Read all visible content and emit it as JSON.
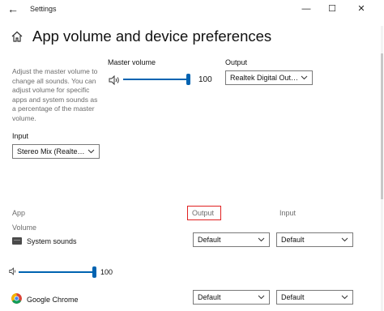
{
  "window": {
    "title": "Settings",
    "back_glyph": "←",
    "minimize_glyph": "—",
    "maximize_glyph": "☐",
    "close_glyph": "✕"
  },
  "page": {
    "title": "App volume and device preferences",
    "description": "Adjust the master volume to change all sounds. You can adjust volume for specific apps and system sounds as a percentage of the master volume."
  },
  "master": {
    "label": "Master volume",
    "value": "100",
    "level": 1.0,
    "output_label": "Output",
    "output_value": "Realtek Digital Out…",
    "input_label": "Input",
    "input_value": "Stereo Mix (Realte…"
  },
  "apps_table": {
    "col_app": "App",
    "col_output": "Output",
    "col_input": "Input",
    "volume_label": "Volume",
    "rows": [
      {
        "name": "System sounds",
        "icon": "speaker-device-icon",
        "output": "Default",
        "input": "Default",
        "volume": "100",
        "level": 1.0
      },
      {
        "name": "Google Chrome",
        "icon": "chrome-icon",
        "output": "Default",
        "input": "Default"
      }
    ]
  },
  "colors": {
    "accent": "#0063b1",
    "highlight_box": "#e02020",
    "muted_text": "#6d6d6d"
  }
}
